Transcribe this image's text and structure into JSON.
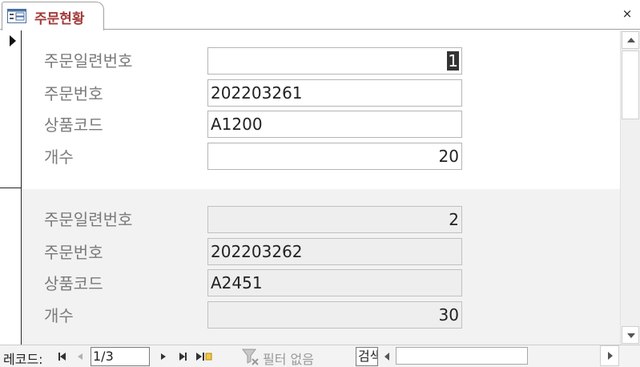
{
  "tab": {
    "title": "주문현황",
    "icon": "form-icon",
    "close_label": "×"
  },
  "records": [
    {
      "fields": [
        {
          "label": "주문일련번호",
          "value": "1",
          "numeric": true,
          "selected": true
        },
        {
          "label": "주문번호",
          "value": "202203261",
          "numeric": false
        },
        {
          "label": "상품코드",
          "value": "A1200",
          "numeric": false
        },
        {
          "label": "개수",
          "value": "20",
          "numeric": true
        }
      ]
    },
    {
      "fields": [
        {
          "label": "주문일련번호",
          "value": "2",
          "numeric": true
        },
        {
          "label": "주문번호",
          "value": "202203262",
          "numeric": false
        },
        {
          "label": "상품코드",
          "value": "A2451",
          "numeric": false
        },
        {
          "label": "개수",
          "value": "30",
          "numeric": true
        }
      ]
    }
  ],
  "navigation": {
    "record_label": "레코드:",
    "current_record": "1/3",
    "filter_label": "필터 없음",
    "search_value": "검색"
  },
  "colors": {
    "tab_title": "#a33a3a",
    "label_text": "#7a7a7a",
    "alt_record_bg": "#f2f2f2"
  }
}
